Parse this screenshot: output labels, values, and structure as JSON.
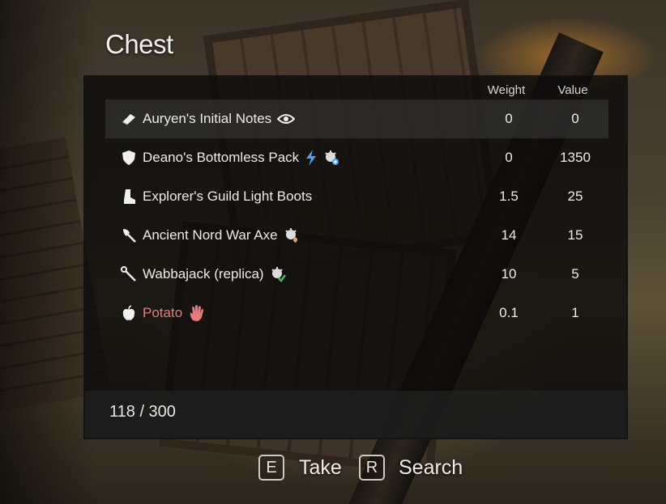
{
  "menu": {
    "title": "Chest"
  },
  "columns": {
    "weight": "Weight",
    "value": "Value"
  },
  "items": [
    {
      "name": "Auryen's Initial Notes",
      "weight": "0",
      "value": "0",
      "icon": "book-icon",
      "badge": "eye-icon",
      "stolen": false,
      "selected": true
    },
    {
      "name": "Deano's Bottomless Pack",
      "weight": "0",
      "value": "1350",
      "icon": "shield-icon",
      "badge": "lightning-icon",
      "badge2": "enchant-icon",
      "stolen": false,
      "selected": false
    },
    {
      "name": "Explorer's Guild Light Boots",
      "weight": "1.5",
      "value": "25",
      "icon": "boots-icon",
      "stolen": false,
      "selected": false
    },
    {
      "name": "Ancient Nord War Axe",
      "weight": "14",
      "value": "15",
      "icon": "axe-icon",
      "badge": "artifact-icon",
      "stolen": false,
      "selected": false
    },
    {
      "name": "Wabbajack (replica)",
      "weight": "10",
      "value": "5",
      "icon": "staff-icon",
      "badge": "artifact-check-icon",
      "stolen": false,
      "selected": false
    },
    {
      "name": "Potato",
      "weight": "0.1",
      "value": "1",
      "icon": "apple-icon",
      "badge": "hand-icon",
      "stolen": true,
      "selected": false
    }
  ],
  "footer": {
    "carry_weight": "118 / 300"
  },
  "prompts": [
    {
      "key": "E",
      "label": "Take"
    },
    {
      "key": "R",
      "label": "Search"
    }
  ],
  "colors": {
    "stolen": "#e87a7a",
    "accent_blue": "#4aa3ff"
  }
}
